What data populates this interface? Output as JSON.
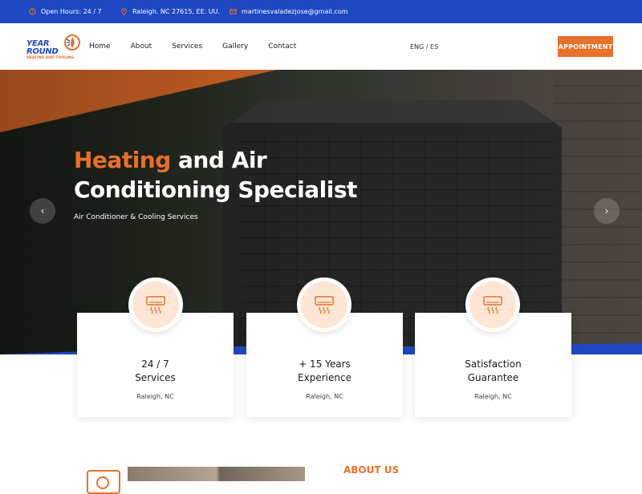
{
  "topbar": {
    "hours": "Open Hours: 24 / 7",
    "location": "Raleigh, NC 27615, EE. UU.",
    "email": "martinesvaladezjose@gmail.com"
  },
  "header": {
    "logo": {
      "line1": "YEAR",
      "line2": "ROUND",
      "tagline": "HEATING AND COOLING"
    },
    "nav": [
      "Home",
      "About",
      "Services",
      "Gallery",
      "Contact"
    ],
    "language": "ENG / ES",
    "cta_label": "APPOINTMENT"
  },
  "hero": {
    "title_accent": "Heating",
    "title_rest_1": " and Air",
    "title_line2": "Conditioning Specialist",
    "subtitle": "Air Conditioner & Cooling Services",
    "prev_arrow": "‹",
    "next_arrow": "›"
  },
  "features": [
    {
      "title_line1": "24 / 7",
      "title_line2": "Services",
      "location": "Raleigh, NC",
      "icon": "air-conditioner-icon"
    },
    {
      "title_line1": "+ 15 Years",
      "title_line2": "Experience",
      "location": "Raleigh, NC",
      "icon": "air-conditioner-icon"
    },
    {
      "title_line1": "Satisfaction",
      "title_line2": "Guarantee",
      "location": "Raleigh, NC",
      "icon": "air-conditioner-icon"
    }
  ],
  "about": {
    "heading": "ABOUT US"
  },
  "colors": {
    "brand_blue": "#1f47c2",
    "accent_orange": "#e9702a",
    "icon_bg": "#fde6d6"
  }
}
